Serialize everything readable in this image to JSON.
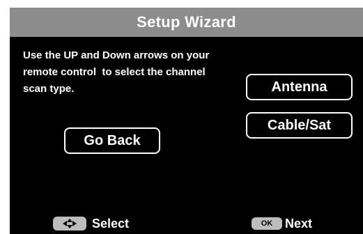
{
  "header": {
    "title": "Setup Wizard"
  },
  "instructions": {
    "line1": "Use the UP and Down arrows on your",
    "line2": "remote control  to select the channel",
    "line3": "scan type."
  },
  "options": {
    "antenna_label": "Antenna",
    "cable_sat_label": "Cable/Sat"
  },
  "navigation": {
    "go_back_label": "Go Back"
  },
  "footer": {
    "select_icon": "dpad-icon",
    "select_label": "Select",
    "ok_key_label": "OK",
    "next_label": "Next"
  },
  "colors": {
    "background": "#000000",
    "title_bar": "#8c8c8c",
    "text": "#ffffff",
    "key_fill": "#bdbdbd"
  }
}
